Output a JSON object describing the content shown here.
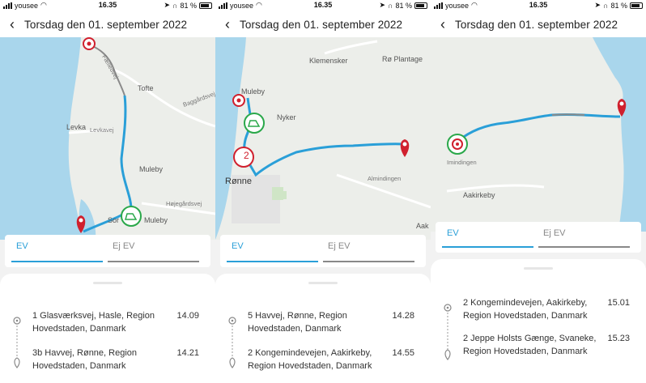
{
  "screens": [
    {
      "status": {
        "carrier": "yousee",
        "time": "16.35",
        "battery": "81 %"
      },
      "header": {
        "title": "Torsdag den 01. september 2022"
      },
      "map_labels": [
        "Tofte",
        "Levka",
        "Levkavej",
        "Muleby",
        "Højegårdsvej",
        "Muleby",
        "Baggårdsvej",
        "Fælledvej",
        "Sor"
      ],
      "tabs": {
        "ev": "EV",
        "non_ev": "Ej EV"
      },
      "trip": {
        "from": {
          "address": "1 Glasværksvej, Hasle, Region Hovedstaden, Danmark",
          "time": "14.09"
        },
        "to": {
          "address": "3b Havvej, Rønne, Region Hovedstaden, Danmark",
          "time": "14.21"
        }
      }
    },
    {
      "status": {
        "carrier": "yousee",
        "time": "16.35",
        "battery": "81 %"
      },
      "header": {
        "title": "Torsdag den 01. september 2022"
      },
      "map_labels": [
        "Klemensker",
        "Rø Plantage",
        "Muleby",
        "Nyker",
        "Rønne",
        "Almindingen",
        "Aak"
      ],
      "marker_number": "2",
      "tabs": {
        "ev": "EV",
        "non_ev": "Ej EV"
      },
      "trip": {
        "from": {
          "address": "5 Havvej, Rønne, Region Hovedstaden, Danmark",
          "time": "14.28"
        },
        "to": {
          "address": "2 Kongemindevejen, Aakirkeby, Region Hovedstaden, Danmark",
          "time": "14.55"
        }
      }
    },
    {
      "status": {
        "carrier": "yousee",
        "time": "16.35",
        "battery": "81 %"
      },
      "header": {
        "title": "Torsdag den 01. september 2022"
      },
      "map_labels": [
        "Imindingen",
        "Aakirkeby"
      ],
      "tabs": {
        "ev": "EV",
        "non_ev": "Ej EV"
      },
      "trip": {
        "from": {
          "address": "2 Kongemindevejen, Aakirkeby, Region Hovedstaden, Danmark",
          "time": "15.01"
        },
        "to": {
          "address": "2 Jeppe Holsts Gænge, Svaneke, Region Hovedstaden, Danmark",
          "time": "15.23"
        }
      }
    }
  ],
  "colors": {
    "route": "#2a9fd8",
    "route_gray": "#8a8a8a",
    "pin": "#d0202e",
    "charger": "#2aa84a",
    "sea": "#a9d6ec",
    "land": "#eceeea"
  },
  "icons": [
    "back-arrow-icon",
    "map-pin-icon",
    "charger-icon",
    "start-marker-icon",
    "origin-dot-icon",
    "destination-pin-icon"
  ]
}
